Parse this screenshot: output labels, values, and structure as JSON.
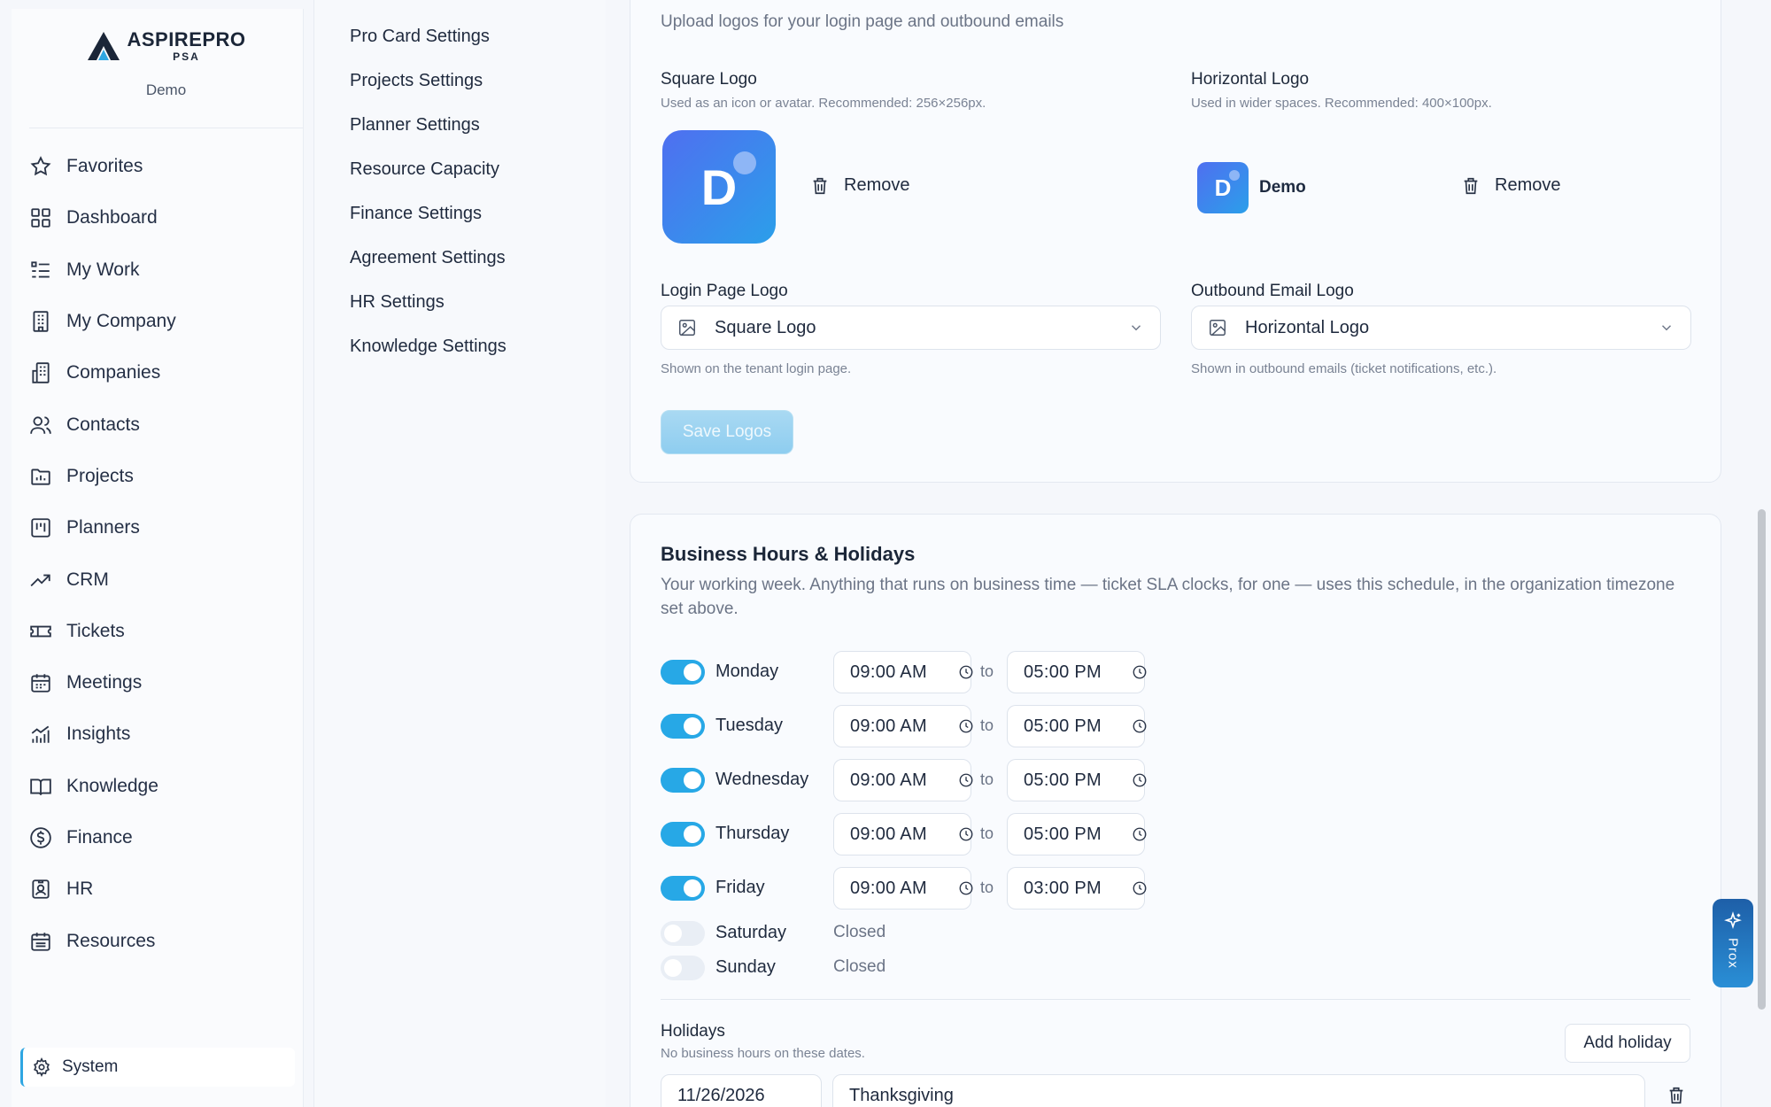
{
  "brand": {
    "name": "ASPIREPRO",
    "sub": "PSA",
    "org": "Demo"
  },
  "nav": [
    {
      "label": "Favorites",
      "icon": "star-icon"
    },
    {
      "label": "Dashboard",
      "icon": "dashboard-icon"
    },
    {
      "label": "My Work",
      "icon": "list-icon"
    },
    {
      "label": "My Company",
      "icon": "building-icon"
    },
    {
      "label": "Companies",
      "icon": "buildings-icon"
    },
    {
      "label": "Contacts",
      "icon": "users-icon"
    },
    {
      "label": "Projects",
      "icon": "folder-icon"
    },
    {
      "label": "Planners",
      "icon": "planner-icon"
    },
    {
      "label": "CRM",
      "icon": "trend-icon"
    },
    {
      "label": "Tickets",
      "icon": "ticket-icon"
    },
    {
      "label": "Meetings",
      "icon": "calendar-icon"
    },
    {
      "label": "Insights",
      "icon": "chart-icon"
    },
    {
      "label": "Knowledge",
      "icon": "book-icon"
    },
    {
      "label": "Finance",
      "icon": "dollar-icon"
    },
    {
      "label": "HR",
      "icon": "badge-icon"
    },
    {
      "label": "Resources",
      "icon": "calendar-grid-icon"
    }
  ],
  "system_label": "System",
  "subnav": [
    "Pro Card Settings",
    "Projects Settings",
    "Planner Settings",
    "Resource Capacity",
    "Finance Settings",
    "Agreement Settings",
    "HR Settings",
    "Knowledge Settings"
  ],
  "logos": {
    "description": "Upload logos for your login page and outbound emails",
    "square_title": "Square Logo",
    "square_hint": "Used as an icon or avatar. Recommended: 256×256px.",
    "horizontal_title": "Horizontal Logo",
    "horizontal_hint": "Used in wider spaces. Recommended: 400×100px.",
    "tile_letter": "D",
    "horizontal_text": "Demo",
    "remove_label": "Remove",
    "login_title": "Login Page Logo",
    "login_value": "Square Logo",
    "login_hint": "Shown on the tenant login page.",
    "email_title": "Outbound Email Logo",
    "email_value": "Horizontal Logo",
    "email_hint": "Shown in outbound emails (ticket notifications, etc.).",
    "save_label": "Save Logos"
  },
  "hours": {
    "title": "Business Hours & Holidays",
    "description": "Your working week. Anything that runs on business time — ticket SLA clocks, for one — uses this schedule, in the organization timezone set above.",
    "to_label": "to",
    "days": [
      {
        "name": "Monday",
        "open": true,
        "start": "09:00 AM",
        "end": "05:00 PM"
      },
      {
        "name": "Tuesday",
        "open": true,
        "start": "09:00 AM",
        "end": "05:00 PM"
      },
      {
        "name": "Wednesday",
        "open": true,
        "start": "09:00 AM",
        "end": "05:00 PM"
      },
      {
        "name": "Thursday",
        "open": true,
        "start": "09:00 AM",
        "end": "05:00 PM"
      },
      {
        "name": "Friday",
        "open": true,
        "start": "09:00 AM",
        "end": "03:00 PM"
      },
      {
        "name": "Saturday",
        "open": false,
        "status": "Closed"
      },
      {
        "name": "Sunday",
        "open": false,
        "status": "Closed"
      }
    ],
    "holidays_title": "Holidays",
    "holidays_hint": "No business hours on these dates.",
    "add_holiday_label": "Add holiday",
    "holidays": [
      {
        "date": "11/26/2026",
        "name": "Thanksgiving"
      }
    ]
  },
  "prox_label": "Prox",
  "colors": {
    "accent": "#27a8e6",
    "logo_tile": "#3b6fe0"
  }
}
